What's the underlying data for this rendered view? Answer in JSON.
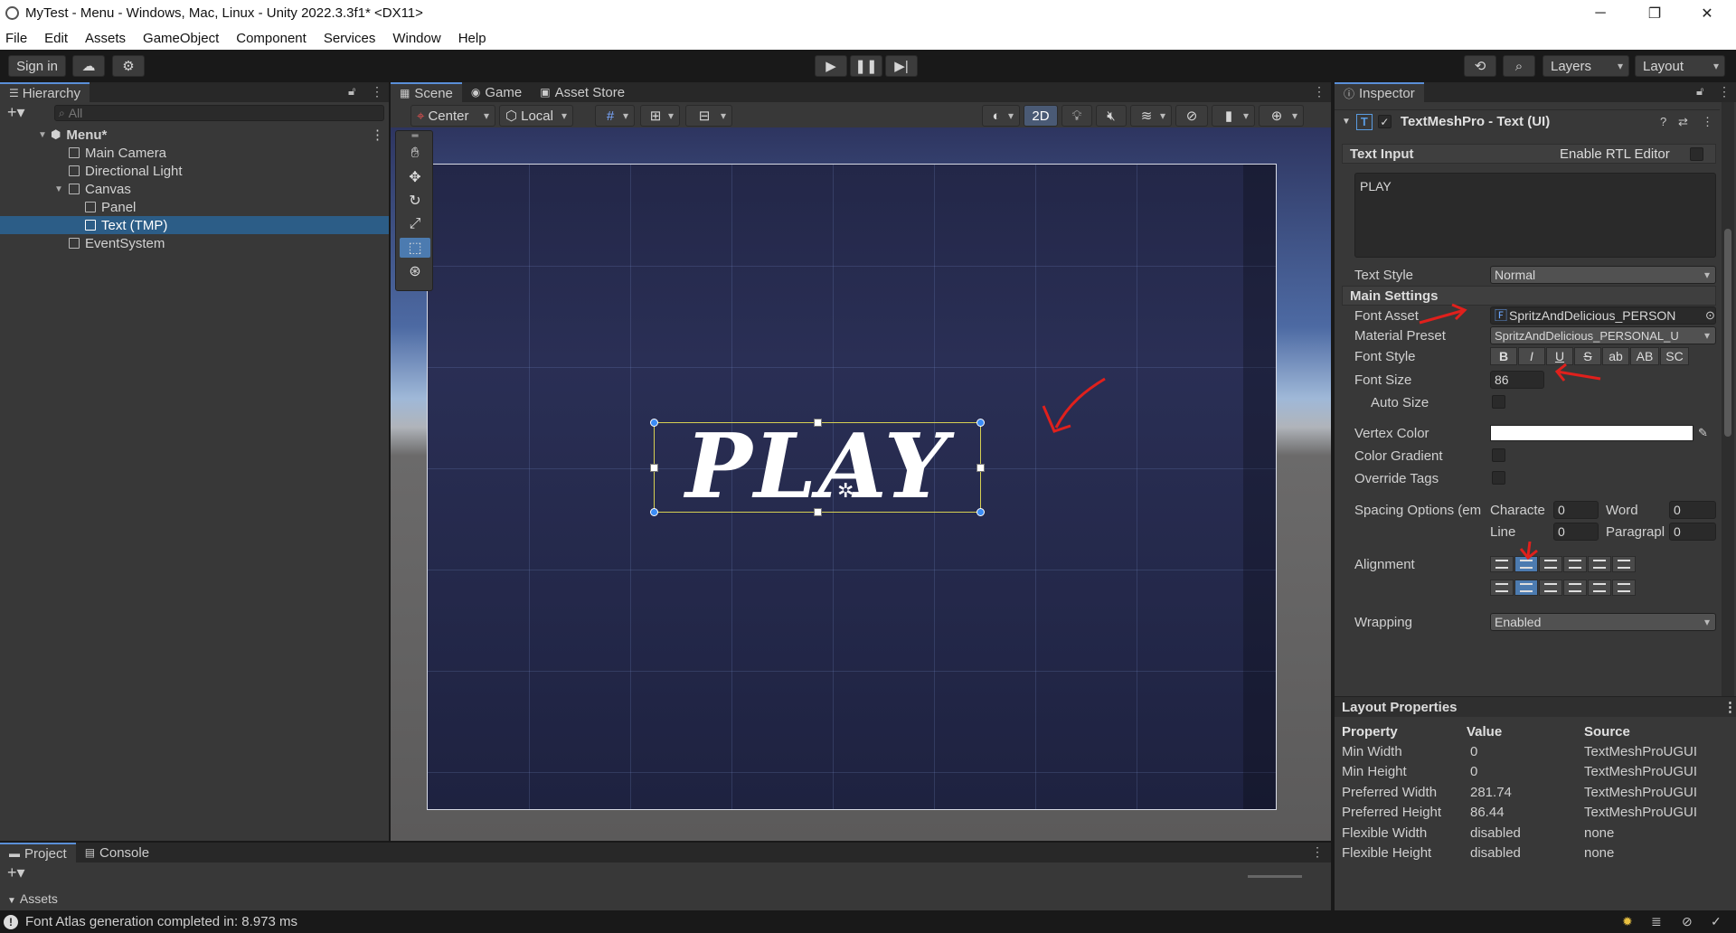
{
  "window": {
    "title": "MyTest - Menu - Windows, Mac, Linux - Unity 2022.3.3f1* <DX11>",
    "minimize": "─",
    "maximize": "❐",
    "close": "✕"
  },
  "menubar": [
    "File",
    "Edit",
    "Assets",
    "GameObject",
    "Component",
    "Services",
    "Window",
    "Help"
  ],
  "toolbar": {
    "sign_in": "Sign in",
    "layers": "Layers",
    "layout": "Layout"
  },
  "hierarchy": {
    "tab": "Hierarchy",
    "search_placeholder": "All",
    "items": [
      {
        "label": "Menu*"
      },
      {
        "label": "Main Camera"
      },
      {
        "label": "Directional Light"
      },
      {
        "label": "Canvas"
      },
      {
        "label": "Panel"
      },
      {
        "label": "Text (TMP)"
      },
      {
        "label": "EventSystem"
      }
    ]
  },
  "scene": {
    "tabs": [
      "Scene",
      "Game",
      "Asset Store"
    ],
    "pivot": "Center",
    "space": "Local",
    "mode_2d": "2D",
    "canvas_text": "PLAY"
  },
  "inspector": {
    "tab": "Inspector",
    "component": "TextMeshPro - Text (UI)",
    "text_input_header": "Text Input",
    "enable_rtl": "Enable RTL Editor",
    "text_value": "PLAY",
    "text_style_label": "Text Style",
    "text_style_value": "Normal",
    "main_settings": "Main Settings",
    "font_asset_label": "Font Asset",
    "font_asset_value": "SpritzAndDelicious_PERSON",
    "material_preset_label": "Material Preset",
    "material_preset_value": "SpritzAndDelicious_PERSONAL_U",
    "font_style_label": "Font Style",
    "font_style_buttons": [
      "B",
      "I",
      "U",
      "S",
      "ab",
      "AB",
      "SC"
    ],
    "font_size_label": "Font Size",
    "font_size_value": "86",
    "auto_size_label": "Auto Size",
    "vertex_color_label": "Vertex Color",
    "color_gradient_label": "Color Gradient",
    "override_tags_label": "Override Tags",
    "spacing_label": "Spacing Options (em",
    "spacing_character_label": "Characte",
    "spacing_character_value": "0",
    "spacing_word_label": "Word",
    "spacing_word_value": "0",
    "spacing_line_label": "Line",
    "spacing_line_value": "0",
    "spacing_paragraph_label": "Paragrapl",
    "spacing_paragraph_value": "0",
    "alignment_label": "Alignment",
    "wrapping_label": "Wrapping",
    "wrapping_value": "Enabled"
  },
  "layout_properties": {
    "header": "Layout Properties",
    "columns": [
      "Property",
      "Value",
      "Source"
    ],
    "rows": [
      [
        "Min Width",
        "0",
        "TextMeshProUGUI"
      ],
      [
        "Min Height",
        "0",
        "TextMeshProUGUI"
      ],
      [
        "Preferred Width",
        "281.74",
        "TextMeshProUGUI"
      ],
      [
        "Preferred Height",
        "86.44",
        "TextMeshProUGUI"
      ],
      [
        "Flexible Width",
        "disabled",
        "none"
      ],
      [
        "Flexible Height",
        "disabled",
        "none"
      ]
    ]
  },
  "bottom": {
    "tabs": [
      "Project",
      "Console"
    ],
    "assets_label": "Assets"
  },
  "status": {
    "message": "Font Atlas generation completed in: 8.973 ms"
  },
  "colors": {
    "selection": "#2c5d87",
    "accent": "#4c7bb0",
    "annotation_red": "#e0201c",
    "scene_bg": "#1e2240"
  }
}
